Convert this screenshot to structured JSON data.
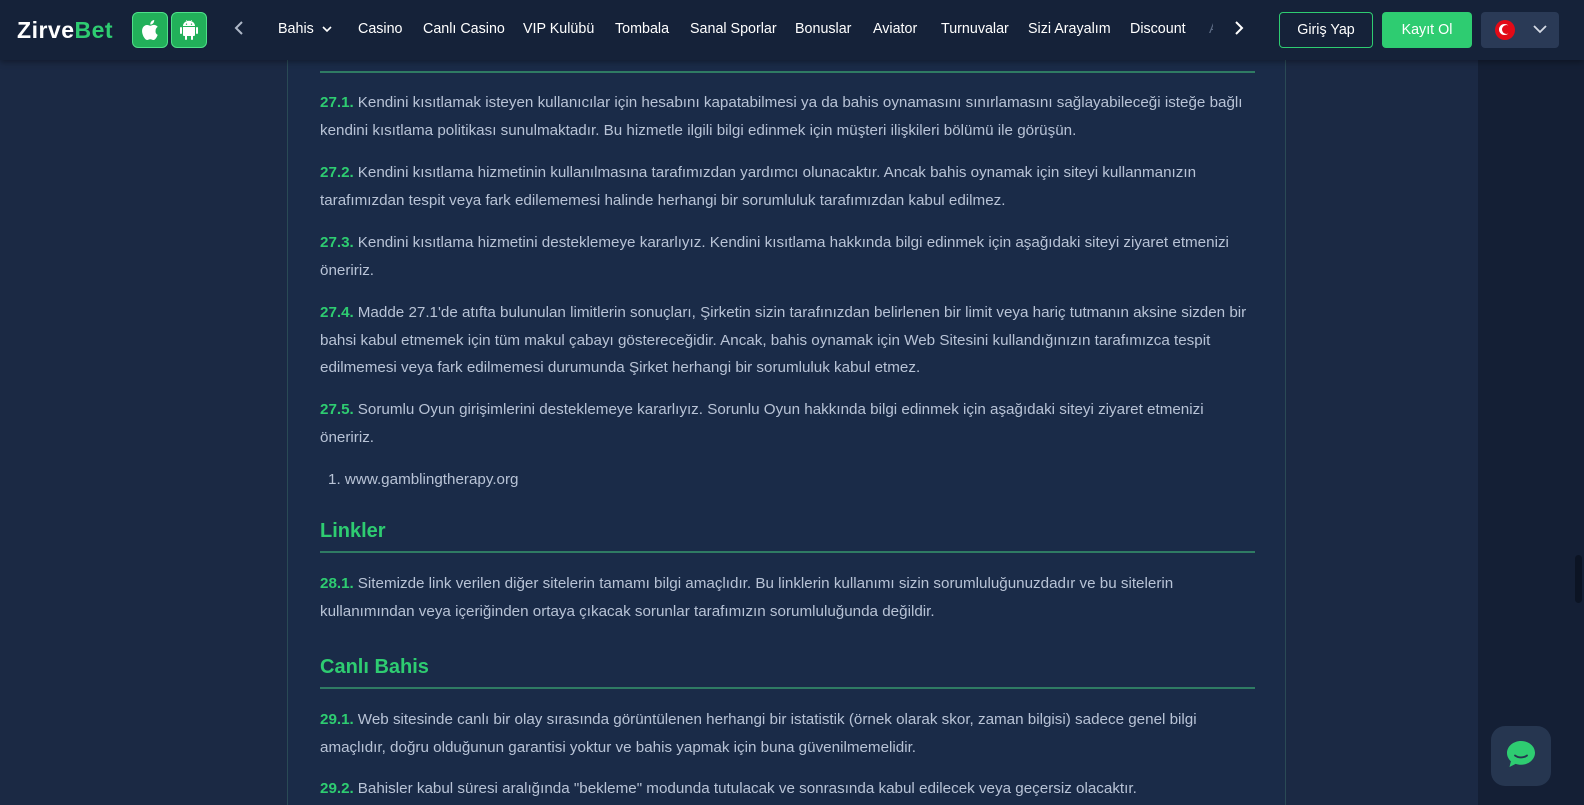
{
  "colors": {
    "accent": "#2ecc71",
    "header_bg": "#152239",
    "page_bg": "#1b2944",
    "text": "#b8c3d6"
  },
  "header": {
    "logo": {
      "part1": "Z",
      "part2": "irve",
      "part3": "Bet"
    },
    "apps": [
      {
        "name": "apple-icon"
      },
      {
        "name": "android-icon"
      }
    ],
    "nav": [
      {
        "label": "Bahis",
        "has_dropdown": true
      },
      {
        "label": "Casino"
      },
      {
        "label": "Canlı Casino"
      },
      {
        "label": "VIP Kulübü"
      },
      {
        "label": "Tombala"
      },
      {
        "label": "Sanal Sporlar"
      },
      {
        "label": "Bonuslar"
      },
      {
        "label": "Aviator"
      },
      {
        "label": "Turnuvalar"
      },
      {
        "label": "Sizi Arayalım"
      },
      {
        "label": "Discount"
      },
      {
        "label": "Af"
      }
    ],
    "login_label": "Giriş Yap",
    "register_label": "Kayıt Ol",
    "language_flag": "tr-flag-icon"
  },
  "content": {
    "sections": [
      {
        "paragraphs": [
          {
            "num": "27.1.",
            "text": "Kendini kısıtlamak isteyen kullanıcılar için hesabını kapatabilmesi ya da bahis oynamasını sınırlamasını sağlayabileceği isteğe bağlı kendini kısıtlama politikası sunulmaktadır. Bu hizmetle ilgili bilgi edinmek için müşteri ilişkileri bölümü ile görüşün."
          },
          {
            "num": "27.2.",
            "text": "Kendini kısıtlama hizmetinin kullanılmasına tarafımızdan yardımcı olunacaktır. Ancak bahis oynamak için siteyi kullanmanızın tarafımızdan tespit veya fark edilememesi halinde herhangi bir sorumluluk tarafımızdan kabul edilmez."
          },
          {
            "num": "27.3.",
            "text": "Kendini kısıtlama hizmetini desteklemeye kararlıyız. Kendini kısıtlama hakkında bilgi edinmek için aşağıdaki siteyi ziyaret etmenizi öneririz."
          },
          {
            "num": "27.4.",
            "text": "Madde 27.1'de atıfta bulunulan limitlerin sonuçları, Şirketin sizin tarafınızdan belirlenen bir limit veya hariç tutmanın aksine sizden bir bahsi kabul etmemek için tüm makul çabayı göstereceğidir. Ancak, bahis oynamak için Web Sitesini kullandığınızın tarafımızca tespit edilmemesi veya fark edilmemesi durumunda Şirket herhangi bir sorumluluk kabul etmez."
          },
          {
            "num": "27.5.",
            "text": "Sorumlu Oyun girişimlerini desteklemeye kararlıyız. Sorunlu Oyun hakkında bilgi edinmek için aşağıdaki siteyi ziyaret etmenizi öneririz."
          }
        ],
        "list": [
          "www.gamblingtherapy.org"
        ]
      },
      {
        "title": "Linkler",
        "paragraphs": [
          {
            "num": "28.1.",
            "text": "Sitemizde link verilen diğer sitelerin tamamı bilgi amaçlıdır. Bu linklerin kullanımı sizin sorumluluğunuzdadır ve bu sitelerin kullanımından veya içeriğinden ortaya çıkacak sorunlar tarafımızın sorumluluğunda değildir."
          }
        ]
      },
      {
        "title": "Canlı Bahis",
        "paragraphs": [
          {
            "num": "29.1.",
            "text": "Web sitesinde canlı bir olay sırasında görüntülenen herhangi bir istatistik (örnek olarak skor, zaman bilgisi) sadece genel bilgi amaçlıdır, doğru olduğunun garantisi yoktur ve bahis yapmak için buna güvenilmemelidir."
          },
          {
            "num": "29.2.",
            "text": "Bahisler kabul süresi aralığında \"bekleme\" modunda tutulacak ve sonrasında kabul edilecek veya geçersiz olacaktır."
          }
        ]
      }
    ]
  },
  "chat": {
    "icon": "chat-bubble-icon"
  }
}
